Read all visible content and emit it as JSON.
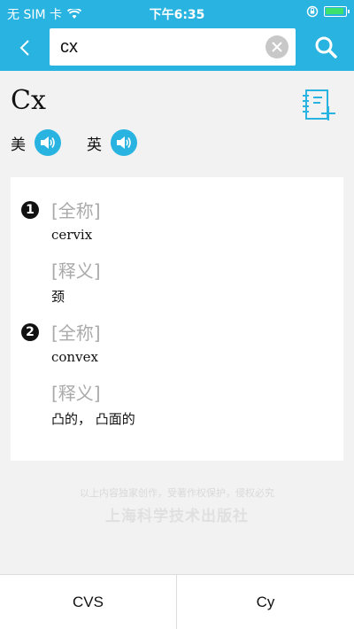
{
  "status_bar": {
    "carrier": "无 SIM 卡",
    "time": "下午6:35"
  },
  "search": {
    "value": "cx",
    "placeholder": ""
  },
  "entry": {
    "headword": "Cx",
    "pron_us_label": "美",
    "pron_uk_label": "英"
  },
  "senses": [
    {
      "num": "1",
      "full_label": "[全称]",
      "full_value": "cervix",
      "meaning_label": "[释义]",
      "meaning_value": "颈"
    },
    {
      "num": "2",
      "full_label": "[全称]",
      "full_value": "convex",
      "meaning_label": "[释义]",
      "meaning_value": "凸的， 凸面的"
    }
  ],
  "footer": {
    "copyright": "以上内容独家创作，受著作权保护，侵权必究",
    "publisher": "上海科学技术出版社"
  },
  "nav": {
    "prev": "CVS",
    "next": "Cy"
  },
  "colors": {
    "accent": "#28b3e0",
    "battery": "#3ce06c"
  }
}
